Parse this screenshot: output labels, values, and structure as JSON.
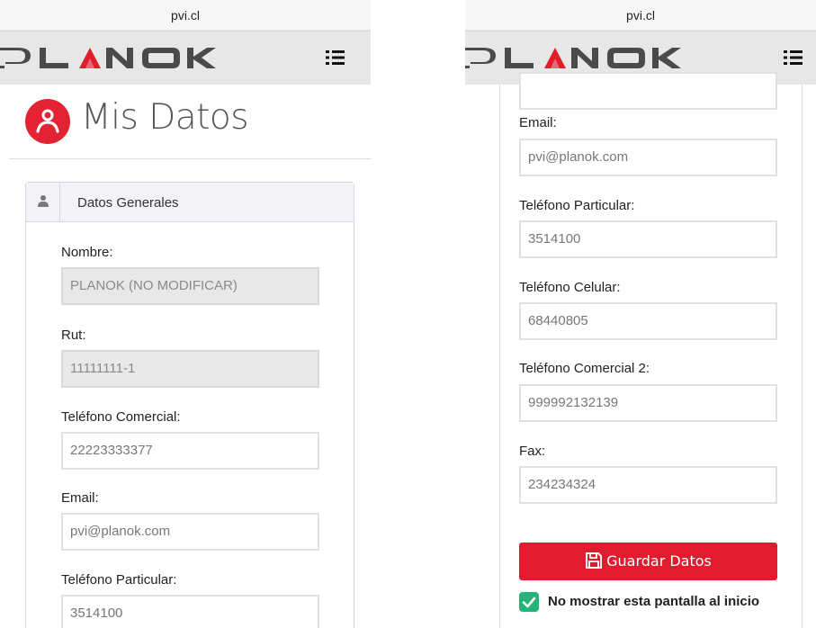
{
  "left_screen": {
    "url": "pvi.cl",
    "logo_text": "PLANOK",
    "menu_icon": "list-menu-icon",
    "page_title": "Mis Datos",
    "page_title_icon": "user-circle-icon",
    "card_header": "Datos Generales",
    "card_header_icon": "user-icon",
    "fields": [
      {
        "label": "Nombre:",
        "value": "PLANOK (NO MODIFICAR)",
        "disabled": true
      },
      {
        "label": "Rut:",
        "value": "11111111-1",
        "disabled": true
      },
      {
        "label": "Teléfono Comercial:",
        "value": "22223333377",
        "disabled": false
      },
      {
        "label": "Email:",
        "value": "pvi@planok.com",
        "disabled": false
      },
      {
        "label": "Teléfono Particular:",
        "value": "3514100",
        "disabled": false
      }
    ]
  },
  "right_screen": {
    "url": "pvi.cl",
    "logo_text": "PLANOK",
    "menu_icon": "list-menu-icon",
    "fields": [
      {
        "label": "Email:",
        "value": "pvi@planok.com"
      },
      {
        "label": "Teléfono Particular:",
        "value": "3514100"
      },
      {
        "label": "Teléfono Celular:",
        "value": "68440805"
      },
      {
        "label": "Teléfono Comercial 2:",
        "value": "999992132139"
      },
      {
        "label": "Fax:",
        "value": "234234324"
      }
    ],
    "save_button": "Guardar Datos",
    "save_icon": "floppy-disk-icon",
    "checkbox_label": "No mostrar esta pantalla al inicio",
    "checkbox_checked": true
  },
  "colors": {
    "brand_red": "#e31b2e",
    "check_green": "#24b37a",
    "nav_gray": "#e7e7e7"
  }
}
